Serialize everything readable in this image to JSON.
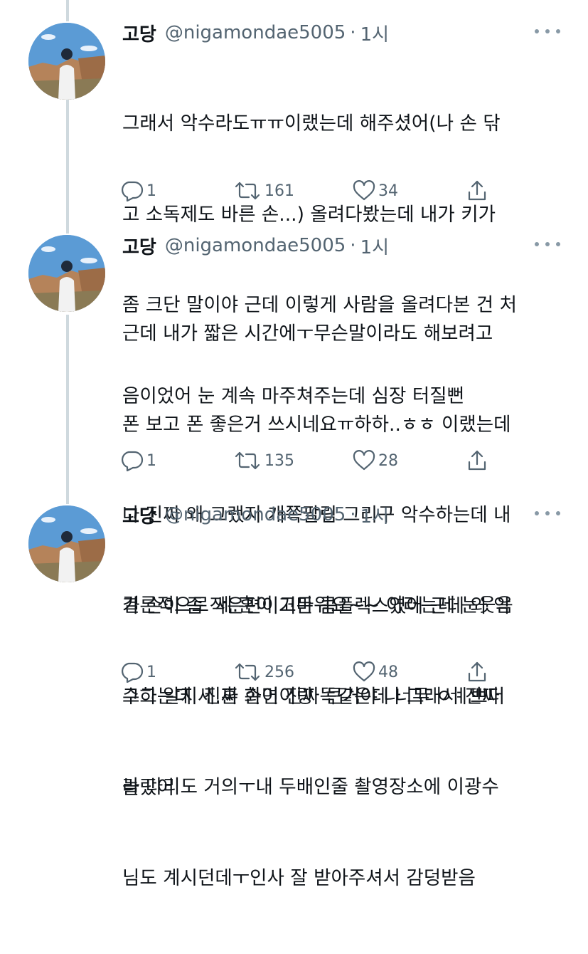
{
  "tweets": [
    {
      "name": "고당",
      "handle": "@nigamondae5005",
      "separator": "·",
      "time": "1시",
      "text": "그래서 악수라도ㅠㅠ이랬는데 해주셨어(나 손 닦고 소독제도 바른 손...) 올려다봤는데 내가 키가 좀 크단 말이야 근데 이렇게 사람을 올려다본 건 처음이었어 눈 계속 마주쳐주는데 심장 터질뻔",
      "lines": [
        "그래서 악수라도ㅠㅠ이랬는데 해주셨어(나 손 닦",
        "고 소독제도 바른 손...) 올려다봤는데 내가 키가",
        "좀 크단 말이야 근데 이렇게 사람을 올려다본 건 처",
        "음이었어 눈 계속 마주쳐주는데 심장 터질뻔"
      ],
      "replies": "1",
      "retweets": "161",
      "likes": "34"
    },
    {
      "name": "고당",
      "handle": "@nigamondae5005",
      "separator": "·",
      "time": "1시",
      "lines": [
        "근데 내가 짧은 시간에ㅜ무슨말이라도 해보려고",
        "폰 보고 폰 좋은거 쓰시네요ㅠ하하..ㅎㅎ 이랬는데",
        "나 진짜 왜 그랬지 개쪽팔림 그리구 악수하는데 내",
        "가 손이 좀 작은편이거든 콤플렉스였어 근데 와 악",
        "수하는데 세.훈 손이 진짜 큰거야 나 그래서 진짜",
        "놀랐어"
      ],
      "replies": "1",
      "retweets": "135",
      "likes": "28"
    },
    {
      "name": "고당",
      "handle": "@nigamondae5005",
      "separator": "·",
      "time": "1시",
      "lines": [
        "결론적으로 세.훈이 고마워요~~ 이러는데 눈웃음",
        "그그 알지 진짜 화면이랑 똑같은데 너무 ㅇㅖ쁘더",
        "라 다리도 거의ㅜ내 두배인줄 촬영장소에 이광수",
        "님도 계시던데ㅜ인사 잘 받아주셔서 감덩받음"
      ],
      "replies": "1",
      "retweets": "256",
      "likes": "48"
    }
  ],
  "icons": {
    "reply": "reply-icon",
    "retweet": "retweet-icon",
    "like": "heart-icon",
    "share": "share-icon",
    "more": "more-icon"
  },
  "colors": {
    "text": "#0f1419",
    "secondary": "#536471",
    "thread_line": "#cfd9de"
  }
}
